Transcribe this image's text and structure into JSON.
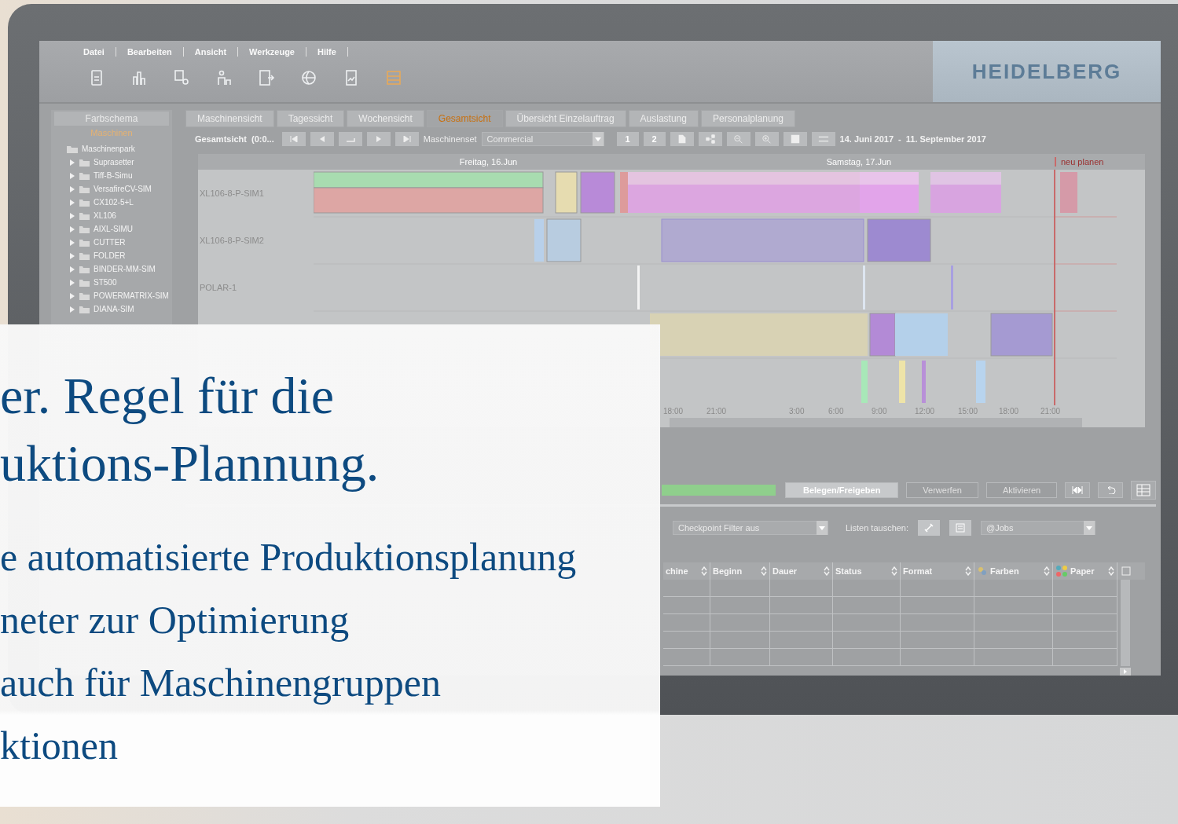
{
  "menu": [
    "Datei",
    "Bearbeiten",
    "Ansicht",
    "Werkzeuge",
    "Hilfe"
  ],
  "toolbar": [
    {
      "kind": "doc",
      "selected": false
    },
    {
      "kind": "chart",
      "selected": false
    },
    {
      "kind": "settings",
      "selected": false
    },
    {
      "kind": "people",
      "selected": false
    },
    {
      "kind": "export",
      "selected": false
    },
    {
      "kind": "globe",
      "selected": false
    },
    {
      "kind": "report",
      "selected": false
    },
    {
      "kind": "board",
      "selected": true
    }
  ],
  "logo": "HEIDELBERG",
  "sidebar": {
    "header": "Farbschema",
    "section": "Maschinen",
    "tree": [
      {
        "label": "Maschinenpark",
        "children": [
          {
            "label": "Suprasetter",
            "expanded": false
          },
          {
            "label": "Tiff-B-Simu",
            "expanded": false
          },
          {
            "label": "VersafireCV-SIM",
            "expanded": false
          },
          {
            "label": "CX102-5+L",
            "expanded": false
          },
          {
            "label": "XL106",
            "expanded": false
          },
          {
            "label": "AIXL-SIMU",
            "expanded": false
          },
          {
            "label": "CUTTER",
            "expanded": false
          },
          {
            "label": "FOLDER",
            "expanded": false
          },
          {
            "label": "BINDER-MM-SIM",
            "expanded": false
          },
          {
            "label": "ST500",
            "expanded": false
          },
          {
            "label": "POWERMATRIX-SIM",
            "expanded": false
          },
          {
            "label": "DIANA-SIM",
            "expanded": false
          }
        ]
      }
    ]
  },
  "tabs": [
    {
      "label": "Maschinensicht",
      "selected": false
    },
    {
      "label": "Tagessicht",
      "selected": false
    },
    {
      "label": "Wochensicht",
      "selected": false
    },
    {
      "label": "Gesamtsicht",
      "selected": true
    },
    {
      "label": "Übersicht Einzelauftrag",
      "selected": false
    },
    {
      "label": "Auslastung",
      "selected": false
    },
    {
      "label": "Personalplanung",
      "selected": false
    }
  ],
  "view_toolbar": {
    "title": "Gesamtsicht",
    "range": "(0:0...",
    "machineset_label": "Maschinenset",
    "machineset": "Commercial",
    "pages": [
      "1",
      "2"
    ],
    "date_from": "14. Juni 2017",
    "date_sep": "-",
    "date_to": "11. September 2017"
  },
  "gantt": {
    "days": [
      "Freitag, 16.Jun",
      "Samstag, 17.Jun"
    ],
    "replan": "neu planen",
    "rows": [
      {
        "label": "XL106-8-P-SIM1"
      },
      {
        "label": "XL106-8-P-SIM2"
      },
      {
        "label": "POLAR-1"
      }
    ],
    "times": [
      "18:00",
      "21:00",
      "3:00",
      "6:00",
      "9:00",
      "12:00",
      "15:00",
      "18:00",
      "21:00"
    ]
  },
  "progress": {
    "level": 1
  },
  "actions": [
    {
      "label": "Belegen/Freigeben",
      "disabled": false
    },
    {
      "label": "Verwerfen",
      "disabled": true
    },
    {
      "label": "Aktivieren",
      "disabled": true
    }
  ],
  "filter": {
    "checkpoint": "Checkpoint Filter aus",
    "swap_label": "Listen tauschen:",
    "list": "@Jobs"
  },
  "table": {
    "columns": [
      {
        "label": "chine",
        "kind": "text"
      },
      {
        "label": "Beginn",
        "kind": "text"
      },
      {
        "label": "Dauer",
        "kind": "text"
      },
      {
        "label": "Status",
        "kind": "text"
      },
      {
        "label": "Format",
        "kind": "text"
      },
      {
        "label": "Farben",
        "kind": "colors"
      },
      {
        "label": "Paper",
        "kind": "paper"
      }
    ]
  },
  "overlay": {
    "heading": [
      "er. Regel für die",
      "uktions-Plannung."
    ],
    "points": [
      "e automatisierte Produktionsplanung",
      "neter zur Optimierung",
      "auch für Maschinengruppen",
      "ktionen"
    ]
  }
}
